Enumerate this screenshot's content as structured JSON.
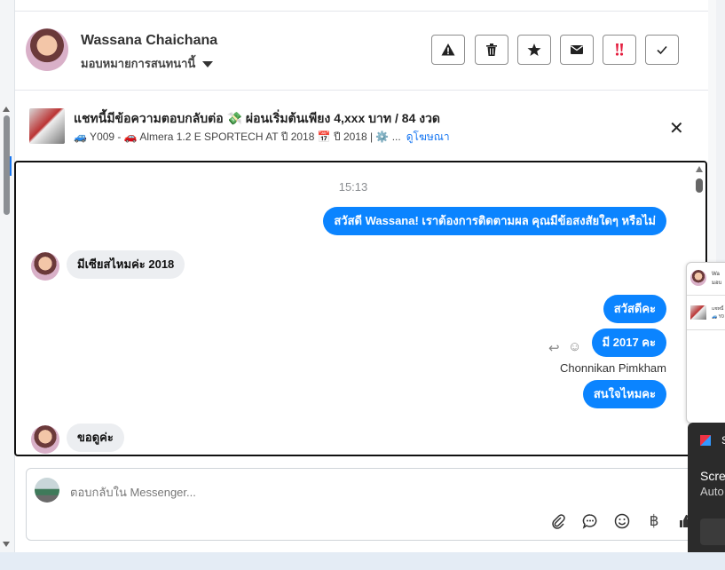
{
  "header": {
    "contact_name": "Wassana Chaichana",
    "assign_label": "มอบหมายการสนทนานี้",
    "buttons": [
      {
        "name": "spam-button",
        "icon": "warning-icon"
      },
      {
        "name": "delete-button",
        "icon": "trash-icon"
      },
      {
        "name": "star-button",
        "icon": "star-icon"
      },
      {
        "name": "mail-button",
        "icon": "envelope-icon"
      },
      {
        "name": "priority-button",
        "icon": "double-exclamation-icon"
      },
      {
        "name": "done-button",
        "icon": "check-icon"
      }
    ]
  },
  "ad": {
    "title": "แชทนี้มีข้อความตอบกลับต่อ 💸 ผ่อนเริ่มต้นเพียง 4,xxx บาท / 84 งวด",
    "subtitle": "🚙 Y009 - 🚗 Almera 1.2 E SPORTECH AT ปี 2018 📅 ปี 2018 | ⚙️ ...",
    "link": "ดูโฆษณา",
    "close": "✕"
  },
  "chat": {
    "timestamp": "15:13",
    "messages": [
      {
        "dir": "out",
        "text": "สวัสดี Wassana! เราต้องการติดตามผล คุณมีข้อสงสัยใดๆ หรือไม่"
      },
      {
        "dir": "in",
        "text": "มีเซียสไหมค่ะ 2018"
      },
      {
        "dir": "out",
        "text": "สวัสดีคะ"
      },
      {
        "dir": "out",
        "text": "มี 2017 คะ"
      },
      {
        "dir": "out",
        "text": "สนใจไหมคะ"
      },
      {
        "dir": "in",
        "text": "ขอดูค่ะ"
      }
    ],
    "sender_name": "Chonnikan Pimkham"
  },
  "composer": {
    "placeholder": "ตอบกลับใน Messenger...",
    "icons": [
      "paperclip-icon",
      "chat-bubble-icon",
      "smiley-icon",
      "baht-icon",
      "thumbs-up-icon"
    ],
    "baht_symbol": "฿"
  },
  "toast": {
    "line1": "Scree",
    "line2": "Auto",
    "label": "S"
  },
  "popup": {
    "line1": "Wa",
    "line2": "มอบ",
    "line3": "แชทนี้",
    "line4": "🚙 Y0"
  },
  "colors": {
    "accent": "#0b84ff",
    "priority_red": "#e41e3f",
    "link": "#1877f2"
  }
}
